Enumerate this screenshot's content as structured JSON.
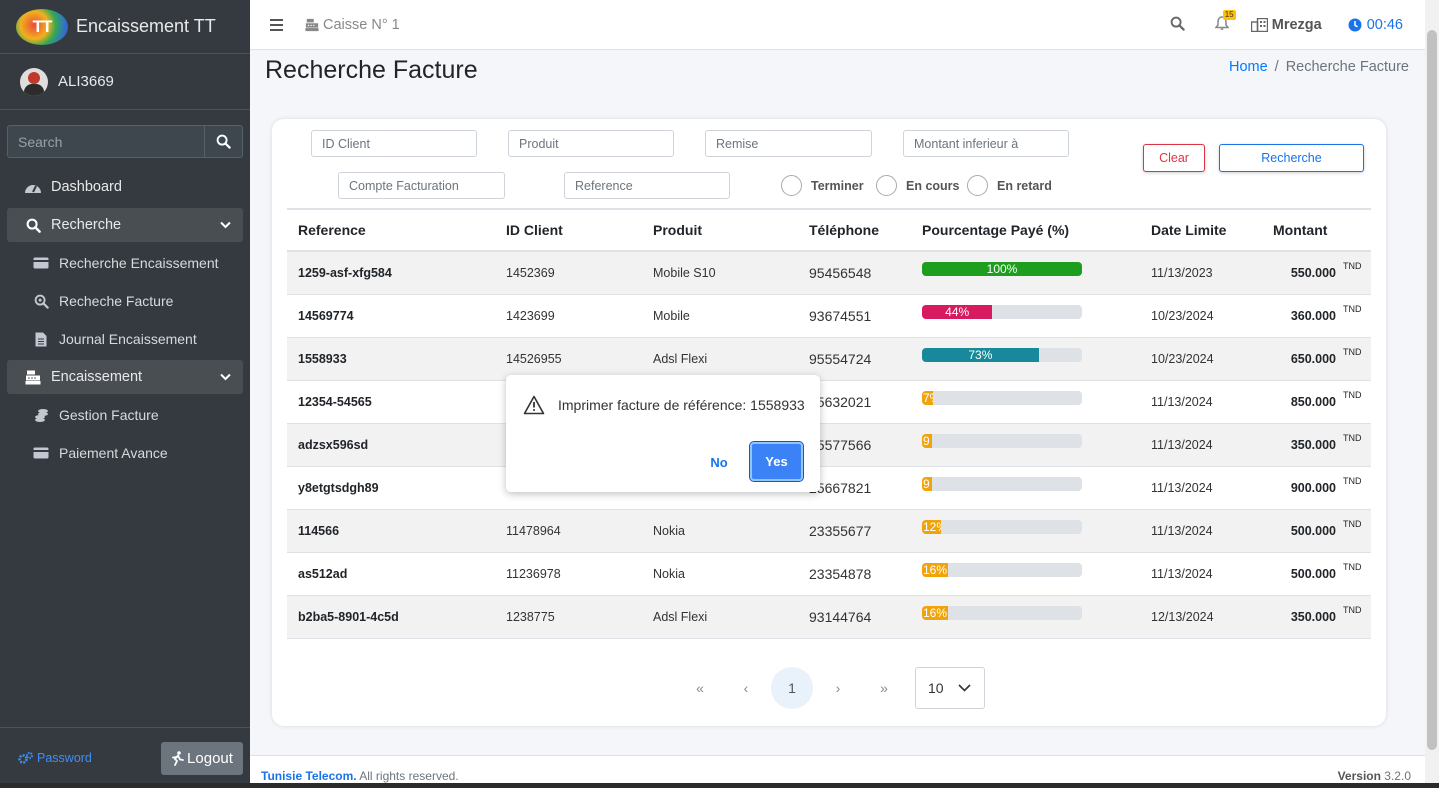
{
  "app": {
    "title": "Encaissement TT",
    "logo_text": "TT"
  },
  "user": {
    "name": "ALI3669"
  },
  "sidebar": {
    "search_placeholder": "Search",
    "items": {
      "dashboard": "Dashboard",
      "recherche": "Recherche",
      "recherche_encaissement": "Recherche Encaissement",
      "recheche_facture": "Recheche Facture",
      "journal_encaissement": "Journal Encaissement",
      "encaissement": "Encaissement",
      "gestion_facture": "Gestion Facture",
      "paiement_avance": "Paiement Avance"
    },
    "password_label": "Password",
    "logout_label": "Logout"
  },
  "topbar": {
    "caisse": "Caisse N° 1",
    "notif_count": "15",
    "org": "Mrezga",
    "time": "00:46"
  },
  "page": {
    "title": "Recherche Facture",
    "breadcrumb_home": "Home",
    "breadcrumb_sep": "/",
    "breadcrumb_current": "Recherche Facture"
  },
  "filters": {
    "id_client": "ID Client",
    "produit": "Produit",
    "remise": "Remise",
    "montant": "Montant inferieur à",
    "compte": "Compte Facturation",
    "reference": "Reference",
    "radio_terminer": "Terminer",
    "radio_en_cours": "En cours",
    "radio_en_retard": "En retard",
    "clear": "Clear",
    "recherche": "Recherche"
  },
  "table": {
    "headers": [
      "Reference",
      "ID Client",
      "Produit",
      "Téléphone",
      "Pourcentage Payé (%)",
      "Date Limite",
      "Montant"
    ],
    "currency": "TND",
    "rows": [
      {
        "ref": "1259-asf-xfg584",
        "id": "1452369",
        "prod": "Mobile S10",
        "tel": "95456548",
        "pct": 100,
        "pct_label": "100%",
        "color": "#1e9e1e",
        "date": "11/13/2023",
        "mont": "550.000"
      },
      {
        "ref": "14569774",
        "id": "1423699",
        "prod": "Mobile",
        "tel": "93674551",
        "pct": 44,
        "pct_label": "44%",
        "color": "#d81b60",
        "date": "10/23/2024",
        "mont": "360.000"
      },
      {
        "ref": "1558933",
        "id": "14526955",
        "prod": "Adsl Flexi",
        "tel": "95554724",
        "pct": 73,
        "pct_label": "73%",
        "color": "#17899b",
        "date": "10/23/2024",
        "mont": "650.000"
      },
      {
        "ref": "12354-54565",
        "id": "",
        "prod": "",
        "tel": "95632021",
        "pct": 7,
        "pct_label": "7%",
        "color": "#f0a30a",
        "date": "11/13/2024",
        "mont": "850.000"
      },
      {
        "ref": "adzsx596sd",
        "id": "",
        "prod": "",
        "tel": "95577566",
        "pct": 4,
        "pct_label": "9",
        "color": "#f0a30a",
        "date": "11/13/2024",
        "mont": "350.000"
      },
      {
        "ref": "y8etgtsdgh89",
        "id": "",
        "prod": "",
        "tel": "25667821",
        "pct": 4,
        "pct_label": "9",
        "color": "#f0a30a",
        "date": "11/13/2024",
        "mont": "900.000"
      },
      {
        "ref": "114566",
        "id": "11478964",
        "prod": "Nokia",
        "tel": "23355677",
        "pct": 12,
        "pct_label": "12%",
        "color": "#f0a30a",
        "date": "11/13/2024",
        "mont": "500.000"
      },
      {
        "ref": "as512ad",
        "id": "11236978",
        "prod": "Nokia",
        "tel": "23354878",
        "pct": 16,
        "pct_label": "16%",
        "color": "#f0a30a",
        "date": "11/13/2024",
        "mont": "500.000"
      },
      {
        "ref": "b2ba5-8901-4c5d",
        "id": "1238775",
        "prod": "Adsl Flexi",
        "tel": "93144764",
        "pct": 16,
        "pct_label": "16%",
        "color": "#f0a30a",
        "date": "12/13/2024",
        "mont": "350.000"
      }
    ]
  },
  "pagination": {
    "first": "«",
    "prev": "‹",
    "current": "1",
    "next": "›",
    "last": "»",
    "page_size": "10"
  },
  "popup": {
    "message": "Imprimer facture de référence: 1558933",
    "no": "No",
    "yes": "Yes"
  },
  "footer": {
    "company": "Tunisie Telecom.",
    "rights": "All rights reserved.",
    "version_label": "Version",
    "version": "3.2.0"
  }
}
